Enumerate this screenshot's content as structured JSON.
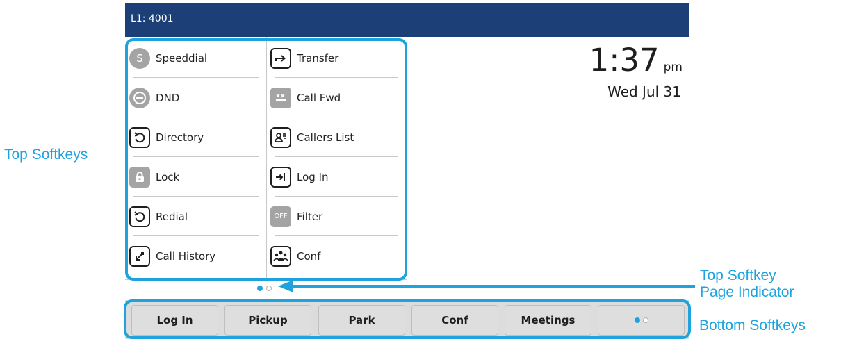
{
  "header": {
    "line_label": "L1: 4001"
  },
  "clock": {
    "time": "1:37",
    "ampm": "pm",
    "date": "Wed Jul 31"
  },
  "top_softkeys": {
    "left": [
      {
        "label": "Speeddial",
        "icon": "speeddial-icon"
      },
      {
        "label": "DND",
        "icon": "dnd-icon"
      },
      {
        "label": "Directory",
        "icon": "directory-icon"
      },
      {
        "label": "Lock",
        "icon": "lock-icon"
      },
      {
        "label": "Redial",
        "icon": "redial-icon"
      },
      {
        "label": "Call History",
        "icon": "call-history-icon"
      }
    ],
    "right": [
      {
        "label": "Transfer",
        "icon": "transfer-icon"
      },
      {
        "label": "Call Fwd",
        "icon": "call-forward-icon"
      },
      {
        "label": "Callers List",
        "icon": "callers-list-icon"
      },
      {
        "label": "Log In",
        "icon": "log-in-icon"
      },
      {
        "label": "Filter",
        "icon": "filter-icon"
      },
      {
        "label": "Conf",
        "icon": "conference-icon"
      }
    ],
    "speeddial_glyph": "S",
    "filter_glyph": "OFF"
  },
  "bottom_softkeys": [
    "Log In",
    "Pickup",
    "Park",
    "Conf",
    "Meetings"
  ],
  "annotations": {
    "top_softkeys": "Top Softkeys",
    "page_indicator_line1": "Top Softkey",
    "page_indicator_line2": "Page Indicator",
    "bottom_softkeys": "Bottom Softkeys"
  },
  "colors": {
    "header_bg": "#1c3f77",
    "accent": "#1ea3df",
    "icon_gray": "#a4a4a4"
  }
}
